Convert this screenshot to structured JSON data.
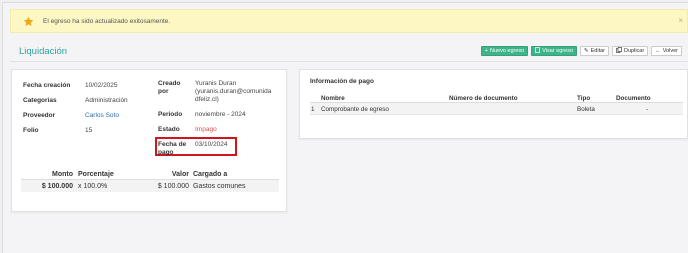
{
  "alert": {
    "message": "El egreso ha sido actualizado exitosamente.",
    "close": "×",
    "icon": "star-icon",
    "color": "#fdf7c3"
  },
  "header": {
    "title": "Liquidación",
    "title_color": "#2aa2a0",
    "buttons": {
      "nuevo_egreso": "Nuevo egreso",
      "visar_egreso": "Visar egreso",
      "editar": "Editar",
      "duplicar": "Duplicar",
      "volver": "Volver"
    }
  },
  "details": {
    "fecha_creacion_label": "Fecha creación",
    "fecha_creacion_value": "10/02/2025",
    "categorias_label": "Categorías",
    "categorias_value": "Administración",
    "proveedor_label": "Proveedor",
    "proveedor_value": "Carlos Soto",
    "folio_label": "Folio",
    "folio_value": "15",
    "creado_por_label_1": "Creado",
    "creado_por_label_2": "por",
    "creado_por_value_1": "Yuranis Duran",
    "creado_por_value_2": "(yuranis.duran@comunida",
    "creado_por_value_3": "dfeliz.cl)",
    "periodo_label": "Periodo",
    "periodo_value": "noviembre - 2024",
    "estado_label": "Estado",
    "estado_value": "Impago",
    "fecha_pago_label_1": "Fecha de",
    "fecha_pago_label_2": "pago",
    "fecha_pago_value": "03/10/2024"
  },
  "amounts": {
    "headers": {
      "monto": "Monto",
      "porcentaje": "Porcentaje",
      "valor": "Valor",
      "cargado_a": "Cargado a"
    },
    "row": {
      "monto": "$ 100.000",
      "porcentaje": "x 100.0%",
      "valor": "$ 100.000",
      "cargado_a": "Gastos comunes"
    }
  },
  "payment_info": {
    "title": "Información de pago",
    "headers": {
      "nombre": "Nombre",
      "numero": "Número de documento",
      "tipo": "Tipo",
      "documento": "Documento"
    },
    "row": {
      "index": "1",
      "nombre": "Comprobante de egreso",
      "numero": "",
      "tipo": "Boleta",
      "documento": "-"
    }
  }
}
